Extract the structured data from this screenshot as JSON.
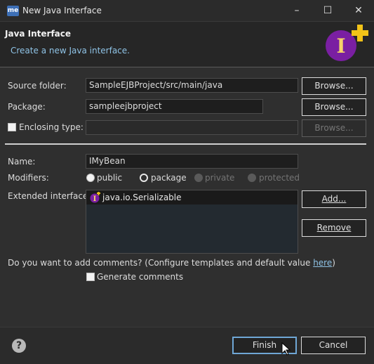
{
  "window": {
    "app_icon_text": "me",
    "title": "New Java Interface",
    "minimize": "–",
    "maximize": "☐",
    "close": "✕"
  },
  "header": {
    "title": "Java Interface",
    "subtitle": "Create a new Java interface."
  },
  "source_folder": {
    "label": "Source folder:",
    "value": "SampleEJBProject/src/main/java",
    "button": "Browse..."
  },
  "package": {
    "label": "Package:",
    "value": "sampleejbproject",
    "button": "Browse..."
  },
  "enclosing": {
    "label": "Enclosing type:",
    "checked": false,
    "value": "",
    "button": "Browse..."
  },
  "name": {
    "label": "Name:",
    "value": "IMyBean"
  },
  "modifiers": {
    "label": "Modifiers:",
    "options": [
      {
        "label": "public",
        "selected": false,
        "enabled": true
      },
      {
        "label": "package",
        "selected": true,
        "enabled": true
      },
      {
        "label": "private",
        "selected": false,
        "enabled": false
      },
      {
        "label": "protected",
        "selected": false,
        "enabled": false
      }
    ]
  },
  "extended": {
    "label": "Extended interfaces:",
    "items": [
      "java.io.Serializable"
    ],
    "add_button": "Add...",
    "remove_button": "Remove"
  },
  "comments": {
    "question": "Do you want to add comments? (Configure templates and default value ",
    "link": "here",
    "suffix": ")",
    "generate_label": "Generate comments",
    "checked": false
  },
  "footer": {
    "help": "?",
    "finish": "Finish",
    "cancel": "Cancel"
  },
  "colors": {
    "accent_link": "#8fc3e6",
    "interface_icon": "#7a1fa2",
    "plus_icon": "#f2c318"
  },
  "icons": {
    "wizard_banner": "interface-add-icon",
    "list_item": "interface-icon"
  }
}
